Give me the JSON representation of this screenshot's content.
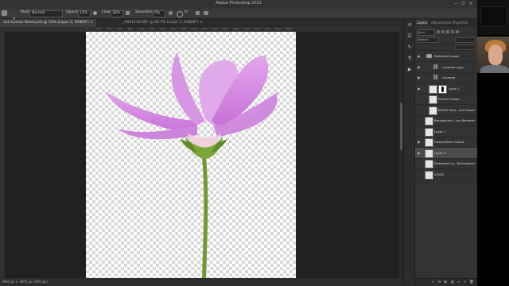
{
  "window": {
    "title": "Adobe Photoshop 2021",
    "controls": [
      "—",
      "❐",
      "✕"
    ]
  },
  "options_bar": {
    "mode_label": "Mode:",
    "mode_value": "Normal",
    "opacity_label": "Opacity:",
    "opacity_value": "10%",
    "flow_label": "Flow:",
    "flow_value": "38%",
    "smoothing_label": "Smoothing:",
    "smoothing_value": "0%",
    "angle_value": "0°"
  },
  "tabs": [
    {
      "label": "and Cosmo Demo.psd @ 50% (Layer 2, RGB/8*) ×",
      "active": true
    },
    {
      "label": "_XS51113.ARF @ 66.7% (Layer 1, RGB/8*) ×",
      "active": false
    }
  ],
  "ruler_ticks": [
    "0",
    "200",
    "400",
    "600",
    "800",
    "1000",
    "1200",
    "1400",
    "1600",
    "1800",
    "2000",
    "2200",
    "2400",
    "2600",
    "2800",
    "3000",
    "3200",
    "3400",
    "3600",
    "3800"
  ],
  "status": {
    "text": "3985 px × 3805 px (300 ppi)"
  },
  "panel": {
    "tabs": [
      "Layers",
      "Adjustments",
      "Properties"
    ],
    "search": "Kind",
    "blend_mode": "Normal",
    "layers": [
      {
        "name": "Perfected Image",
        "type": "group",
        "visible": true,
        "indent": 0
      },
      {
        "name": "Lavende copy",
        "type": "adjustment",
        "visible": true,
        "indent": 2
      },
      {
        "name": "Lavende",
        "type": "adjustment",
        "visible": true,
        "indent": 2
      },
      {
        "name": "Layer 1",
        "type": "mask",
        "visible": true,
        "indent": 1
      },
      {
        "name": "Perfect Flower",
        "type": "pixel",
        "visible": false,
        "indent": 1
      },
      {
        "name": "BR500 Tech...nce Flower",
        "type": "pixel",
        "visible": false,
        "indent": 1
      },
      {
        "name": "Background ...ion Removal",
        "type": "pixel",
        "visible": false,
        "indent": 0
      },
      {
        "name": "Layer 1",
        "type": "pixel",
        "visible": false,
        "indent": 0
      },
      {
        "name": "Flower/Stem Cutout",
        "type": "pixel",
        "visible": true,
        "indent": 0
      },
      {
        "name": "Layer 2",
        "type": "pixel",
        "visible": true,
        "indent": 0,
        "selected": true
      },
      {
        "name": "Perfected Lig...Distractions",
        "type": "pixel",
        "visible": false,
        "indent": 0
      },
      {
        "name": "GOOD",
        "type": "pixel",
        "visible": false,
        "indent": 0
      }
    ],
    "footer_icons": [
      "link-icon",
      "fx-icon",
      "mask-icon",
      "adjustment-icon",
      "folder-icon",
      "new-layer-icon",
      "trash-icon"
    ]
  },
  "colors": {
    "flower_petal": "#d78fe0",
    "stem": "#6f9a2f",
    "panel_bg": "#323232"
  }
}
